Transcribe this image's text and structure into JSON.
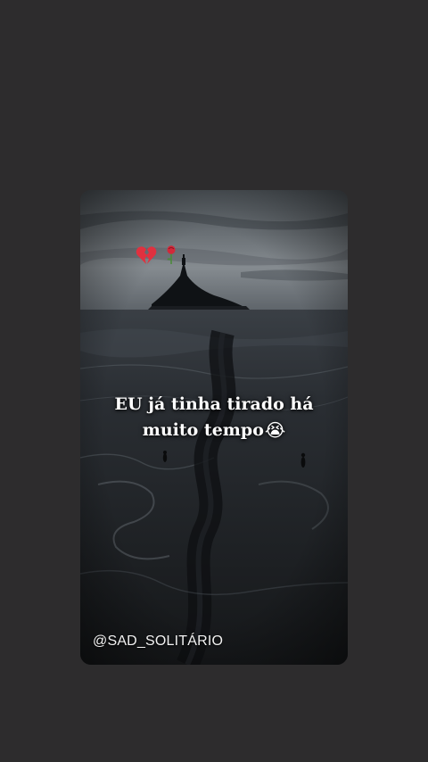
{
  "post": {
    "caption_line1": "EU já tinha tirado há",
    "caption_line2": "muito tempo",
    "caption_emoji": "😭",
    "watermark": "@SAD_SOLITÁRIO",
    "stickers": [
      "broken-heart-icon",
      "rose-icon"
    ]
  },
  "colors": {
    "background": "#2d2c2d",
    "caption_text": "#ffffff",
    "broken_heart": "#e0313f"
  }
}
